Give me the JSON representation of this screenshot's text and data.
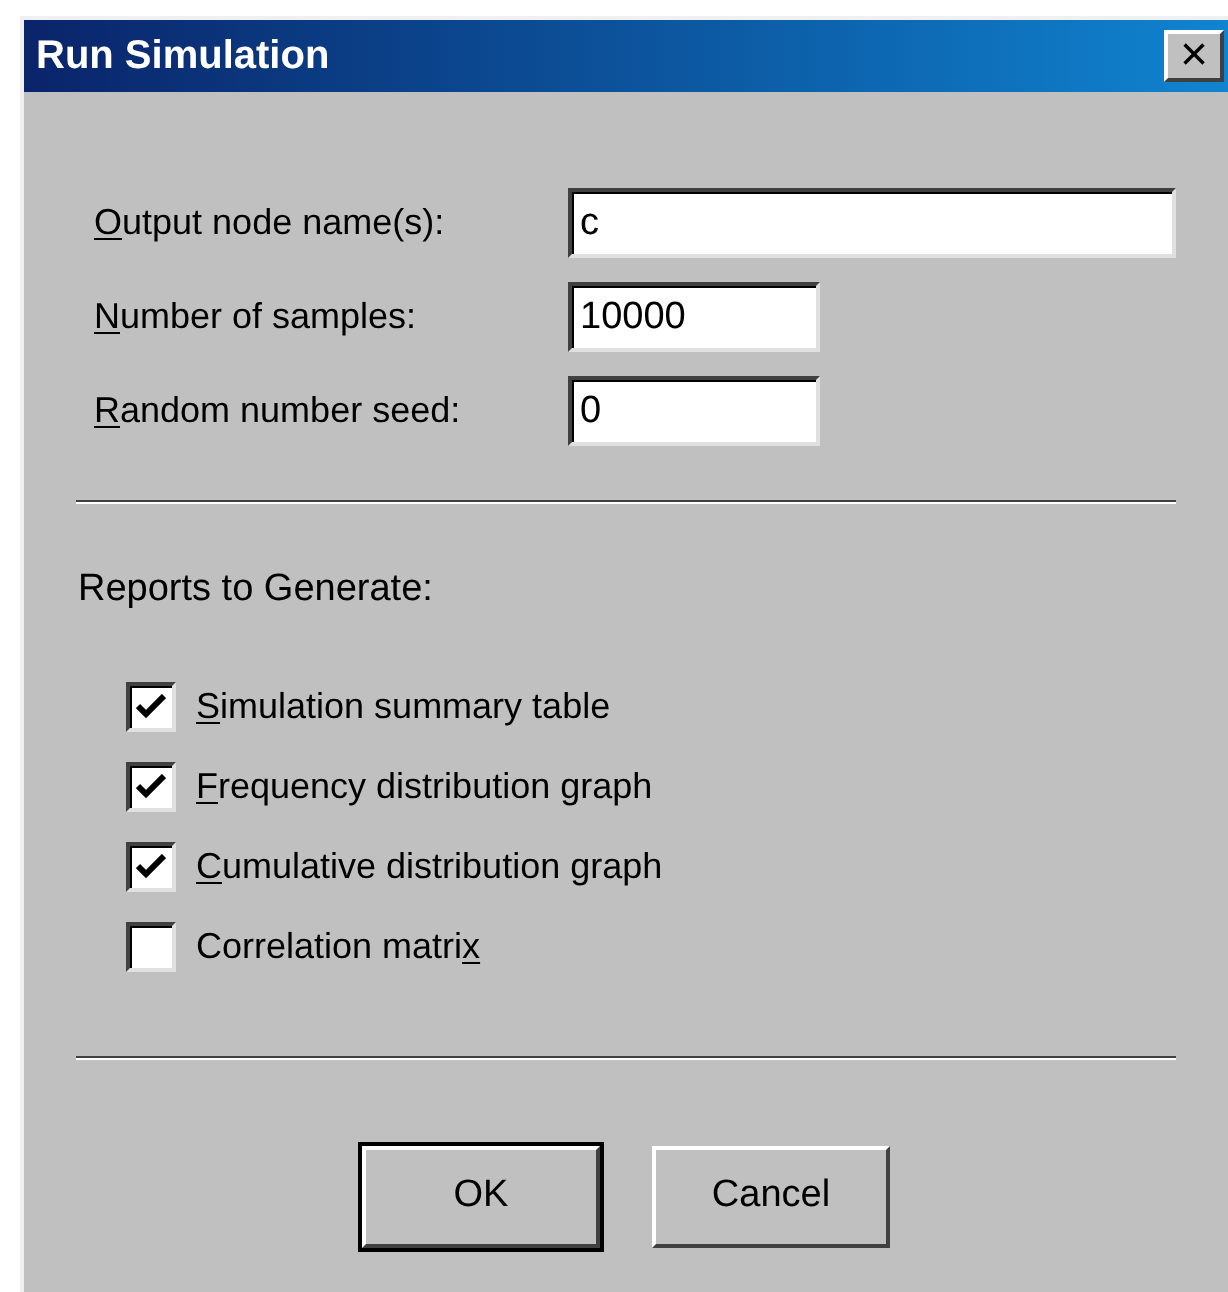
{
  "window": {
    "title": "Run Simulation",
    "close": "×"
  },
  "fields": [
    {
      "access_key": "O",
      "label_end": "utput node name(s):",
      "value": "c",
      "kind": "wide"
    },
    {
      "access_key": "N",
      "label_end": "umber of samples:",
      "value": "10000",
      "kind": "narrow"
    },
    {
      "access_key": "R",
      "label_end": "andom number seed:",
      "value": "0",
      "kind": "narrow"
    }
  ],
  "reports": {
    "heading": "Reports to Generate:",
    "options": [
      {
        "access_key": "S",
        "label_end": "imulation summary table",
        "checked": true
      },
      {
        "access_key": "F",
        "label_end": "requency distribution graph",
        "checked": true
      },
      {
        "access_key": "C",
        "label_end": "umulative distribution graph",
        "checked": true
      },
      {
        "label_start": "Correlation matri",
        "access_key": "x",
        "checked": false
      }
    ]
  },
  "buttons": [
    {
      "label": "OK",
      "default": true
    },
    {
      "label": "Cancel",
      "default": false
    }
  ]
}
